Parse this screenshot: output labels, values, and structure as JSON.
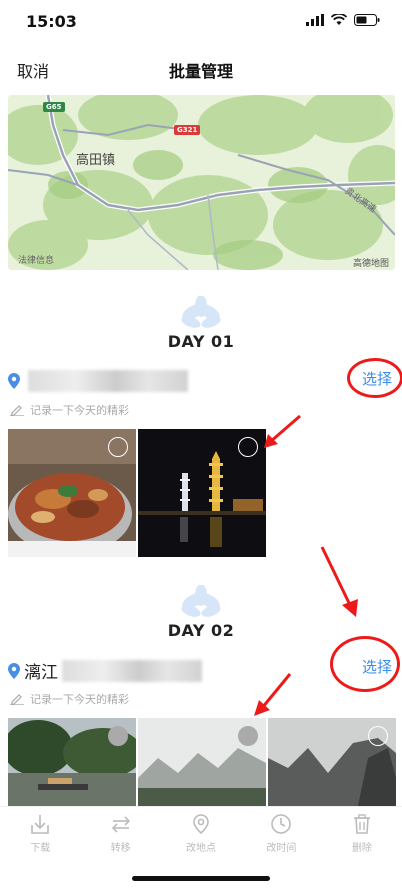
{
  "status": {
    "time": "15:03"
  },
  "nav": {
    "cancel": "取消",
    "title": "批量管理"
  },
  "map": {
    "town": "高田镇",
    "legal": "法律信息",
    "brand": "高德地图",
    "road_g65": "G65",
    "road_g321": "G321",
    "highway": "贵北高速"
  },
  "days": [
    {
      "title": "DAY 01",
      "location": "",
      "note": "记录一下今天的精彩",
      "select": "选择"
    },
    {
      "title": "DAY 02",
      "location": "漓江",
      "note": "记录一下今天的精彩",
      "select": "选择"
    }
  ],
  "toolbar": {
    "items": [
      {
        "label": "下载",
        "icon": "download-icon"
      },
      {
        "label": "转移",
        "icon": "transfer-icon"
      },
      {
        "label": "改地点",
        "icon": "location-icon"
      },
      {
        "label": "改时间",
        "icon": "clock-icon"
      },
      {
        "label": "删除",
        "icon": "trash-icon"
      }
    ]
  },
  "colors": {
    "accent": "#3d8de8",
    "annotation": "#ee1a1a",
    "disabled": "#bbbbbb"
  }
}
